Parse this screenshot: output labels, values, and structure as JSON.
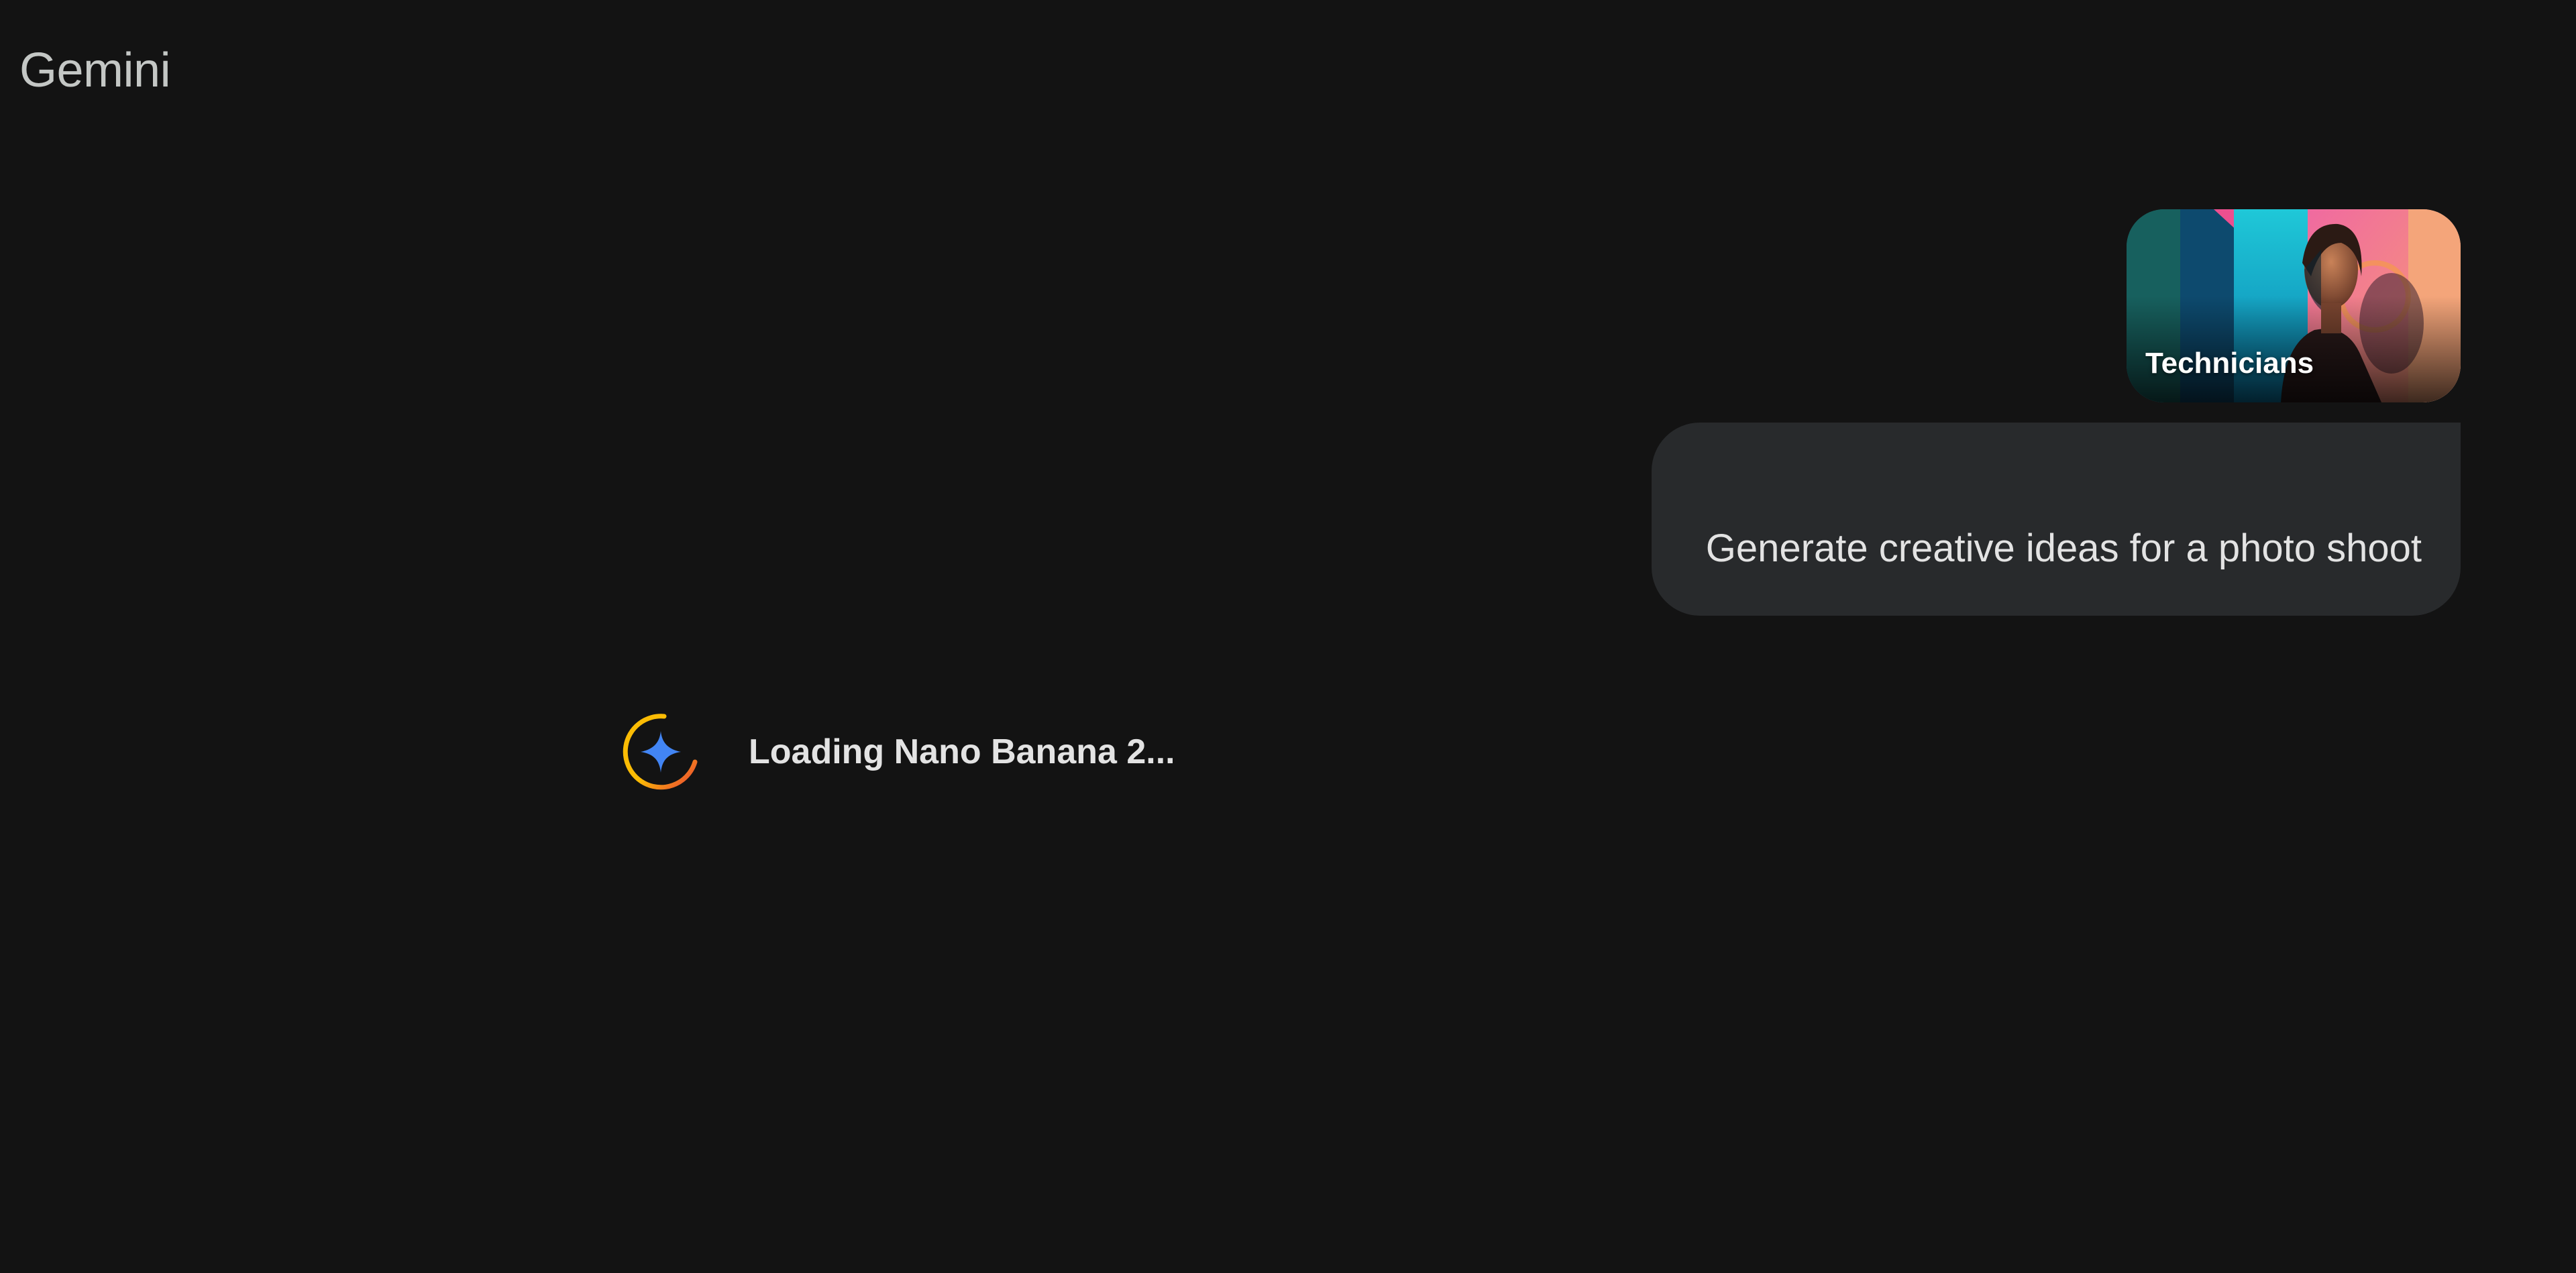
{
  "header": {
    "app_title": "Gemini"
  },
  "conversation": {
    "attachment": {
      "label": "Technicians",
      "thumbnail_icon": "portrait-photo"
    },
    "user_message": {
      "text": "Generate creative ideas for a photo shoot"
    },
    "response": {
      "status_text": "Loading Nano Banana 2...",
      "status_icon": "gemini-sparkle-spinner-icon"
    }
  },
  "colors": {
    "background": "#131313",
    "bubble": "#282a2c",
    "text_primary": "#e3e3e3",
    "title_text": "#c4c7c5",
    "sparkle_blue": "#4285f4",
    "spinner_yellow": "#fbbc04",
    "spinner_red": "#ea4335"
  }
}
